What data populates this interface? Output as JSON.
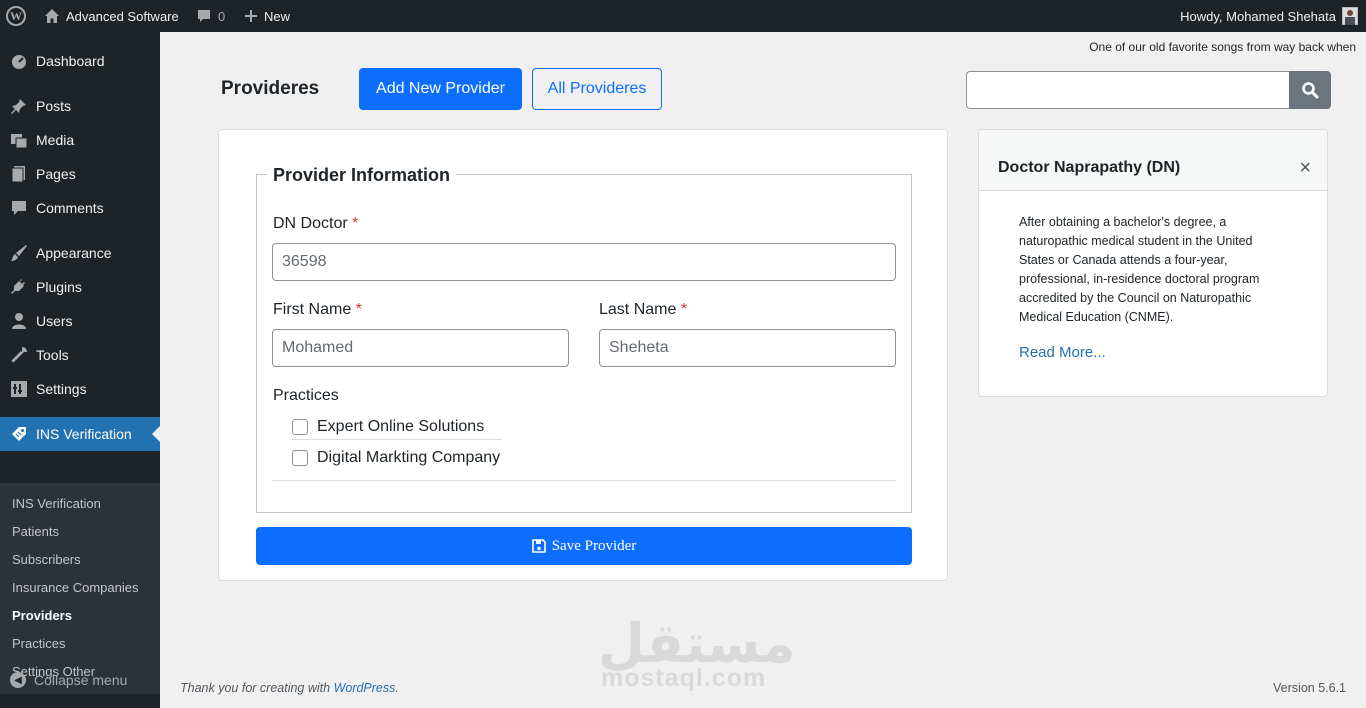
{
  "admin_bar": {
    "logo_icon": "wordpress-icon",
    "site_name": "Advanced Software",
    "comments_count": "0",
    "new_label": "New",
    "howdy": "Howdy, Mohamed Shehata"
  },
  "sidebar": {
    "items": [
      {
        "label": "Dashboard",
        "icon": "dashboard-icon"
      },
      {
        "label": "Posts",
        "icon": "pin-icon"
      },
      {
        "label": "Media",
        "icon": "media-icon"
      },
      {
        "label": "Pages",
        "icon": "pages-icon"
      },
      {
        "label": "Comments",
        "icon": "comment-icon"
      },
      {
        "label": "Appearance",
        "icon": "brush-icon"
      },
      {
        "label": "Plugins",
        "icon": "plug-icon"
      },
      {
        "label": "Users",
        "icon": "user-icon"
      },
      {
        "label": "Tools",
        "icon": "wrench-icon"
      },
      {
        "label": "Settings",
        "icon": "settings-icon"
      },
      {
        "label": "INS Verification",
        "icon": "tag-icon"
      }
    ],
    "submenu": [
      "INS Verification",
      "Patients",
      "Subscribers",
      "Insurance Companies",
      "Providers",
      "Practices",
      "Settings Other"
    ],
    "collapse_label": "Collapse menu"
  },
  "song_line": "One of our old favorite songs from way back when",
  "header": {
    "title": "Provideres",
    "add_button": "Add New Provider",
    "all_button": "All Provideres",
    "search_value": ""
  },
  "form": {
    "legend": "Provider Information",
    "dn_label": "DN Doctor",
    "dn_value": "36598",
    "first_name_label": "First Name",
    "first_name_value": "Mohamed",
    "last_name_label": "Last Name",
    "last_name_value": "Sheheta",
    "required_mark": "*",
    "practices_label": "Practices",
    "practices": [
      "Expert Online Solutions",
      "Digital Markting Company"
    ],
    "save_label": "Save Provider"
  },
  "info_card": {
    "title": "Doctor Naprapathy (DN)",
    "close_glyph": "×",
    "body": "After obtaining a bachelor's degree, a naturopathic medical student in the United States or Canada attends a four-year, professional, in-residence doctoral program accredited by the Council on Naturopathic Medical Education (CNME).",
    "read_more": "Read More..."
  },
  "footer": {
    "thanks_prefix": "Thank you for creating with",
    "thanks_link": "WordPress",
    "thanks_suffix": ".",
    "version": "Version 5.6.1"
  },
  "watermark": {
    "arabic": "مستقل",
    "latin": "mostaql.com"
  }
}
